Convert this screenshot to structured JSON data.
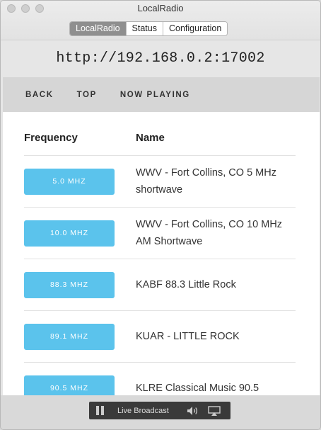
{
  "window": {
    "title": "LocalRadio"
  },
  "tabs": [
    {
      "label": "LocalRadio",
      "active": true
    },
    {
      "label": "Status",
      "active": false
    },
    {
      "label": "Configuration",
      "active": false
    }
  ],
  "url": "http://192.168.0.2:17002",
  "nav": {
    "back": "BACK",
    "top": "TOP",
    "now_playing": "NOW PLAYING"
  },
  "table": {
    "headers": {
      "frequency": "Frequency",
      "name": "Name"
    },
    "rows": [
      {
        "frequency": "5.0 MHZ",
        "name": "WWV - Fort Collins, CO 5 MHz shortwave"
      },
      {
        "frequency": "10.0 MHZ",
        "name": "WWV - Fort Collins, CO 10 MHz AM Shortwave"
      },
      {
        "frequency": "88.3 MHZ",
        "name": "KABF 88.3 Little Rock"
      },
      {
        "frequency": "89.1 MHZ",
        "name": "KUAR - LITTLE ROCK"
      },
      {
        "frequency": "90.5 MHZ",
        "name": "KLRE Classical Music 90.5"
      }
    ]
  },
  "player": {
    "label": "Live Broadcast"
  },
  "colors": {
    "accent": "#5bc3ec",
    "player_bg": "#3a3a3a"
  }
}
